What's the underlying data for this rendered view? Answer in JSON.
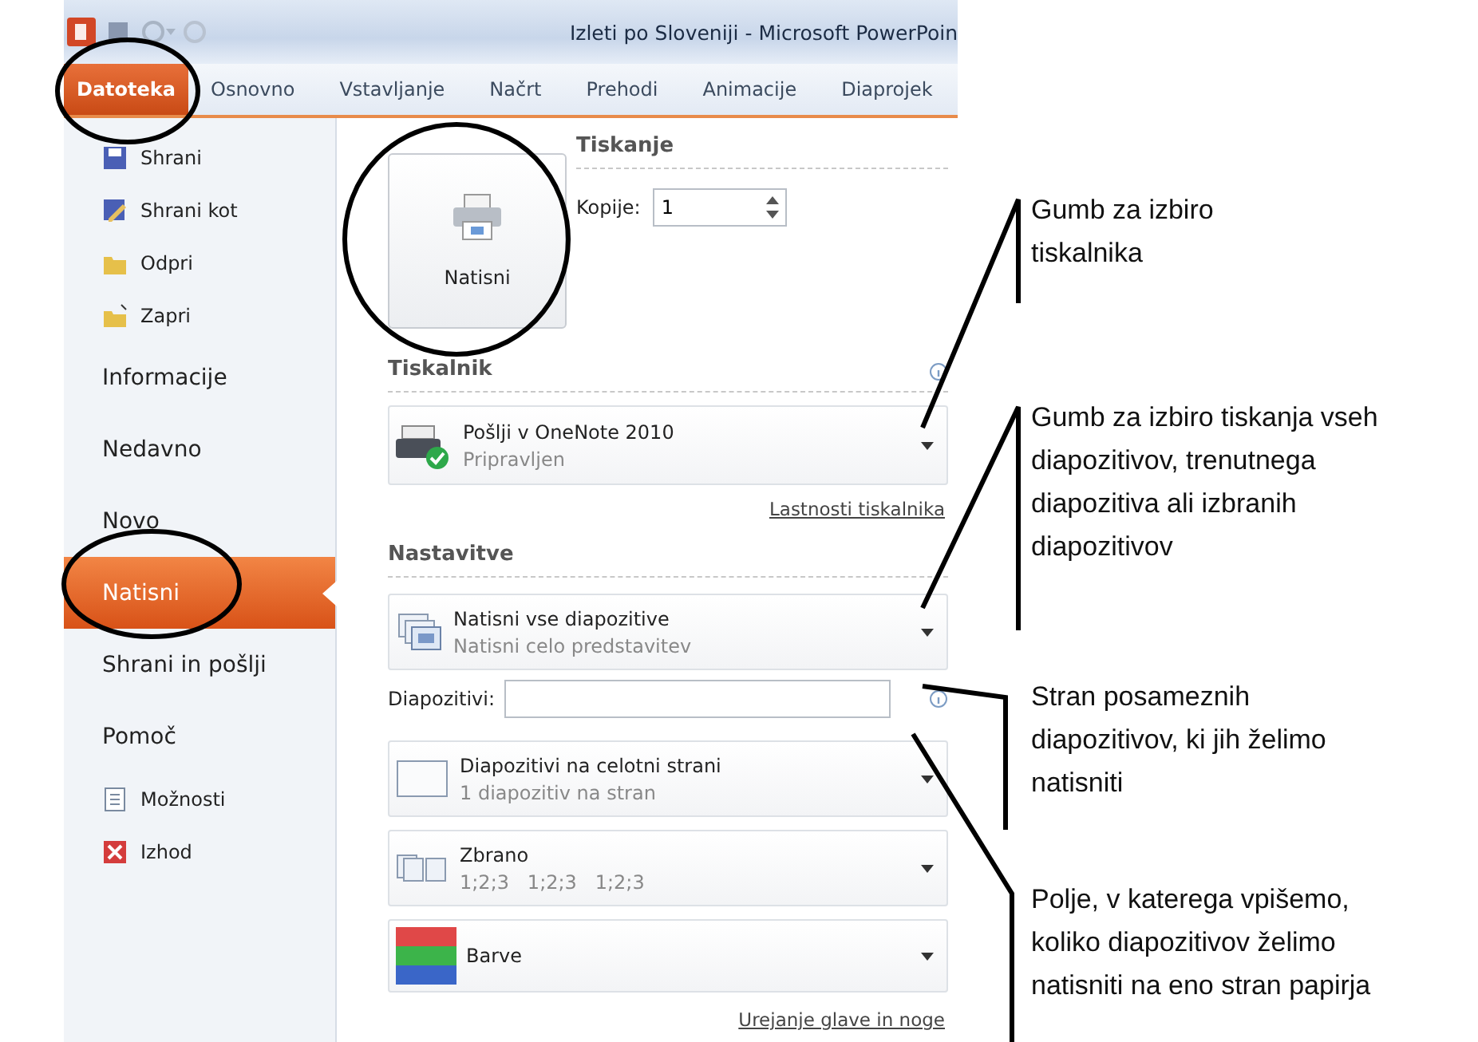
{
  "window": {
    "title": "Izleti po Sloveniji - Microsoft PowerPoin"
  },
  "ribbon_tabs": [
    {
      "label": "Datoteka",
      "selected": true
    },
    {
      "label": "Osnovno",
      "selected": false
    },
    {
      "label": "Vstavljanje",
      "selected": false
    },
    {
      "label": "Načrt",
      "selected": false
    },
    {
      "label": "Prehodi",
      "selected": false
    },
    {
      "label": "Animacije",
      "selected": false
    },
    {
      "label": "Diaprojek",
      "selected": false
    }
  ],
  "backstage_menu": [
    {
      "kind": "save",
      "label": "Shrani",
      "selected": false
    },
    {
      "kind": "saveas",
      "label": "Shrani kot",
      "selected": false
    },
    {
      "kind": "open",
      "label": "Odpri",
      "selected": false
    },
    {
      "kind": "close",
      "label": "Zapri",
      "selected": false
    },
    {
      "kind": "page",
      "label": "Informacije",
      "selected": false
    },
    {
      "kind": "page",
      "label": "Nedavno",
      "selected": false
    },
    {
      "kind": "page",
      "label": "Novo",
      "selected": false
    },
    {
      "kind": "page",
      "label": "Natisni",
      "selected": true
    },
    {
      "kind": "page",
      "label": "Shrani in pošlji",
      "selected": false
    },
    {
      "kind": "page",
      "label": "Pomoč",
      "selected": false
    },
    {
      "kind": "options",
      "label": "Možnosti",
      "selected": false
    },
    {
      "kind": "exit",
      "label": "Izhod",
      "selected": false
    }
  ],
  "print": {
    "title": "Tiskanje",
    "print_button": "Natisni",
    "copies_label": "Kopije:",
    "copies_value": "1"
  },
  "printer": {
    "title": "Tiskalnik",
    "name": "Pošlji v OneNote 2010",
    "status": "Pripravljen",
    "properties_link": "Lastnosti tiskalnika"
  },
  "settings": {
    "title": "Nastavitve",
    "items": [
      {
        "kind": "range",
        "title": "Natisni vse diapozitive",
        "subtitle": "Natisni celo predstavitev"
      },
      {
        "kind": "field",
        "label": "Diapozitivi:"
      },
      {
        "kind": "layout",
        "title": "Diapozitivi na celotni strani",
        "subtitle": "1 diapozitiv na stran"
      },
      {
        "kind": "collate",
        "title": "Zbrano",
        "subtitle": "1;2;3   1;2;3   1;2;3"
      },
      {
        "kind": "color",
        "title": "Barve"
      }
    ],
    "footer_link": "Urejanje glave in noge"
  },
  "annotations": [
    {
      "lines": [
        "Gumb za izbiro",
        "tiskalnika"
      ]
    },
    {
      "lines": [
        "Gumb za izbiro tiskanja vseh",
        "diapozitivov, trenutnega",
        "diapozitiva ali izbranih",
        "diapozitivov"
      ]
    },
    {
      "lines": [
        "Stran posameznih",
        "diapozitivov, ki jih želimo",
        "natisniti"
      ]
    },
    {
      "lines": [
        "Polje, v katerega vpišemo,",
        "koliko diapozitivov želimo",
        "natisniti na eno stran papirja"
      ]
    }
  ]
}
